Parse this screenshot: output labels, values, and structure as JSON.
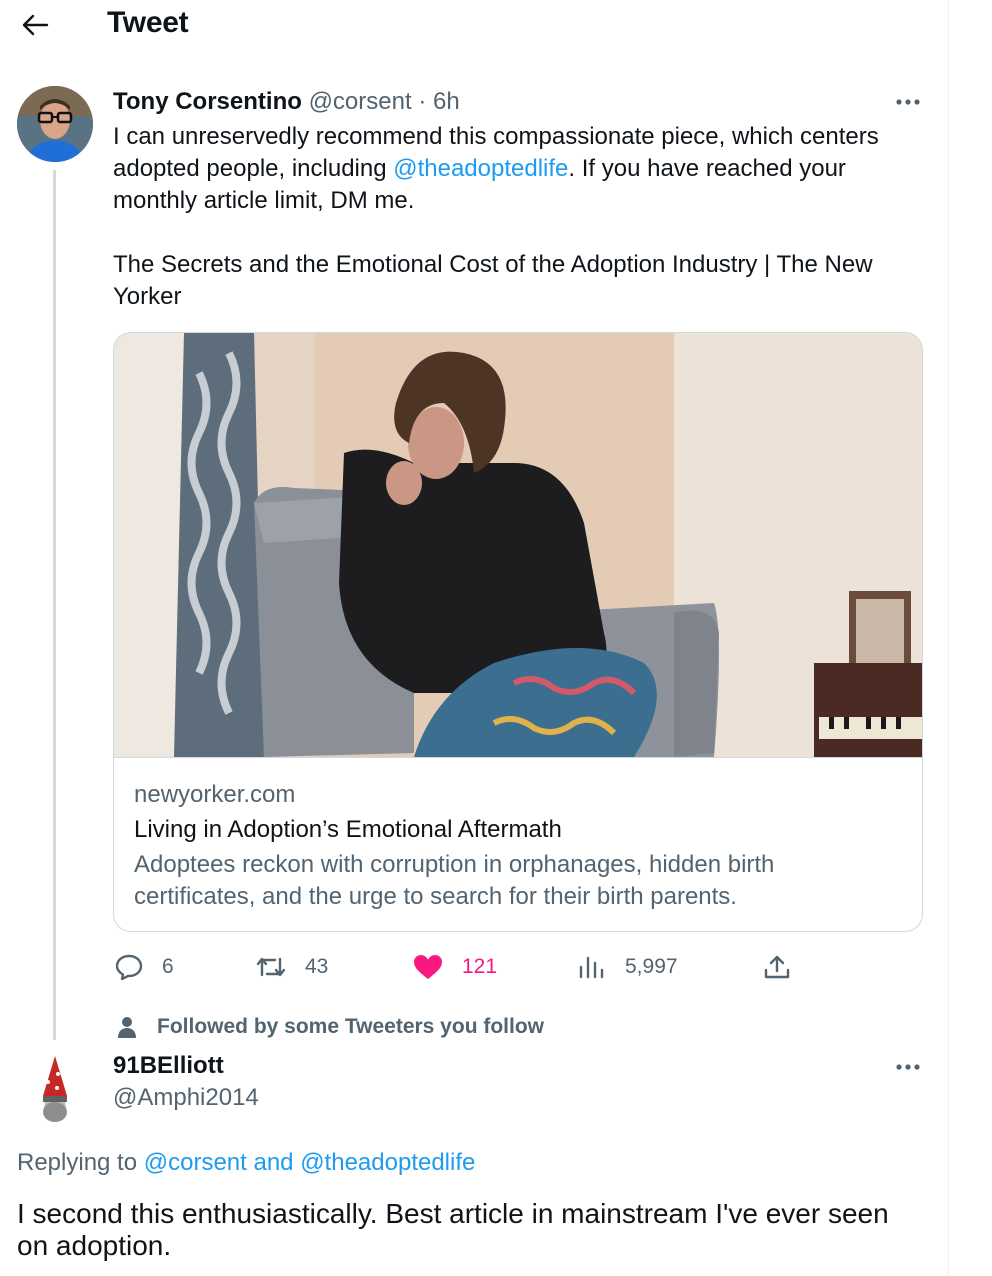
{
  "header": {
    "title": "Tweet",
    "back_icon": "arrow-left-icon"
  },
  "tweet": {
    "author_name": "Tony Corsentino",
    "author_handle": "@corsent",
    "separator": "·",
    "time": "6h",
    "text_part1": "I can unreservedly recommend this compassionate piece, which centers adopted people, including ",
    "mention": "@theadoptedlife",
    "text_part2": ". If you have reached your monthly article limit, DM me.",
    "text_line2": "The Secrets and the Emotional Cost of the Adoption Industry | The New Yorker",
    "card": {
      "domain": "newyorker.com",
      "title": "Living in Adoption’s Emotional Aftermath",
      "description": "Adoptees reckon with corruption in orphanages, hidden birth certificates, and the urge to search for their birth parents."
    },
    "stats": {
      "replies": "6",
      "retweets": "43",
      "likes": "121",
      "views": "5,997"
    },
    "colors": {
      "link": "#1d9bf0",
      "like": "#f91880",
      "muted": "#536471"
    }
  },
  "social_context": {
    "label": "Followed by some Tweeters you follow",
    "icon": "person-icon"
  },
  "reply": {
    "author_name": "91BElliott",
    "author_handle": "@Amphi2014",
    "replying_prefix": "Replying to ",
    "replying_to": "@corsent and @theadoptedlife",
    "text": "I second this enthusiastically. Best article in mainstream I've ever seen on adoption."
  }
}
